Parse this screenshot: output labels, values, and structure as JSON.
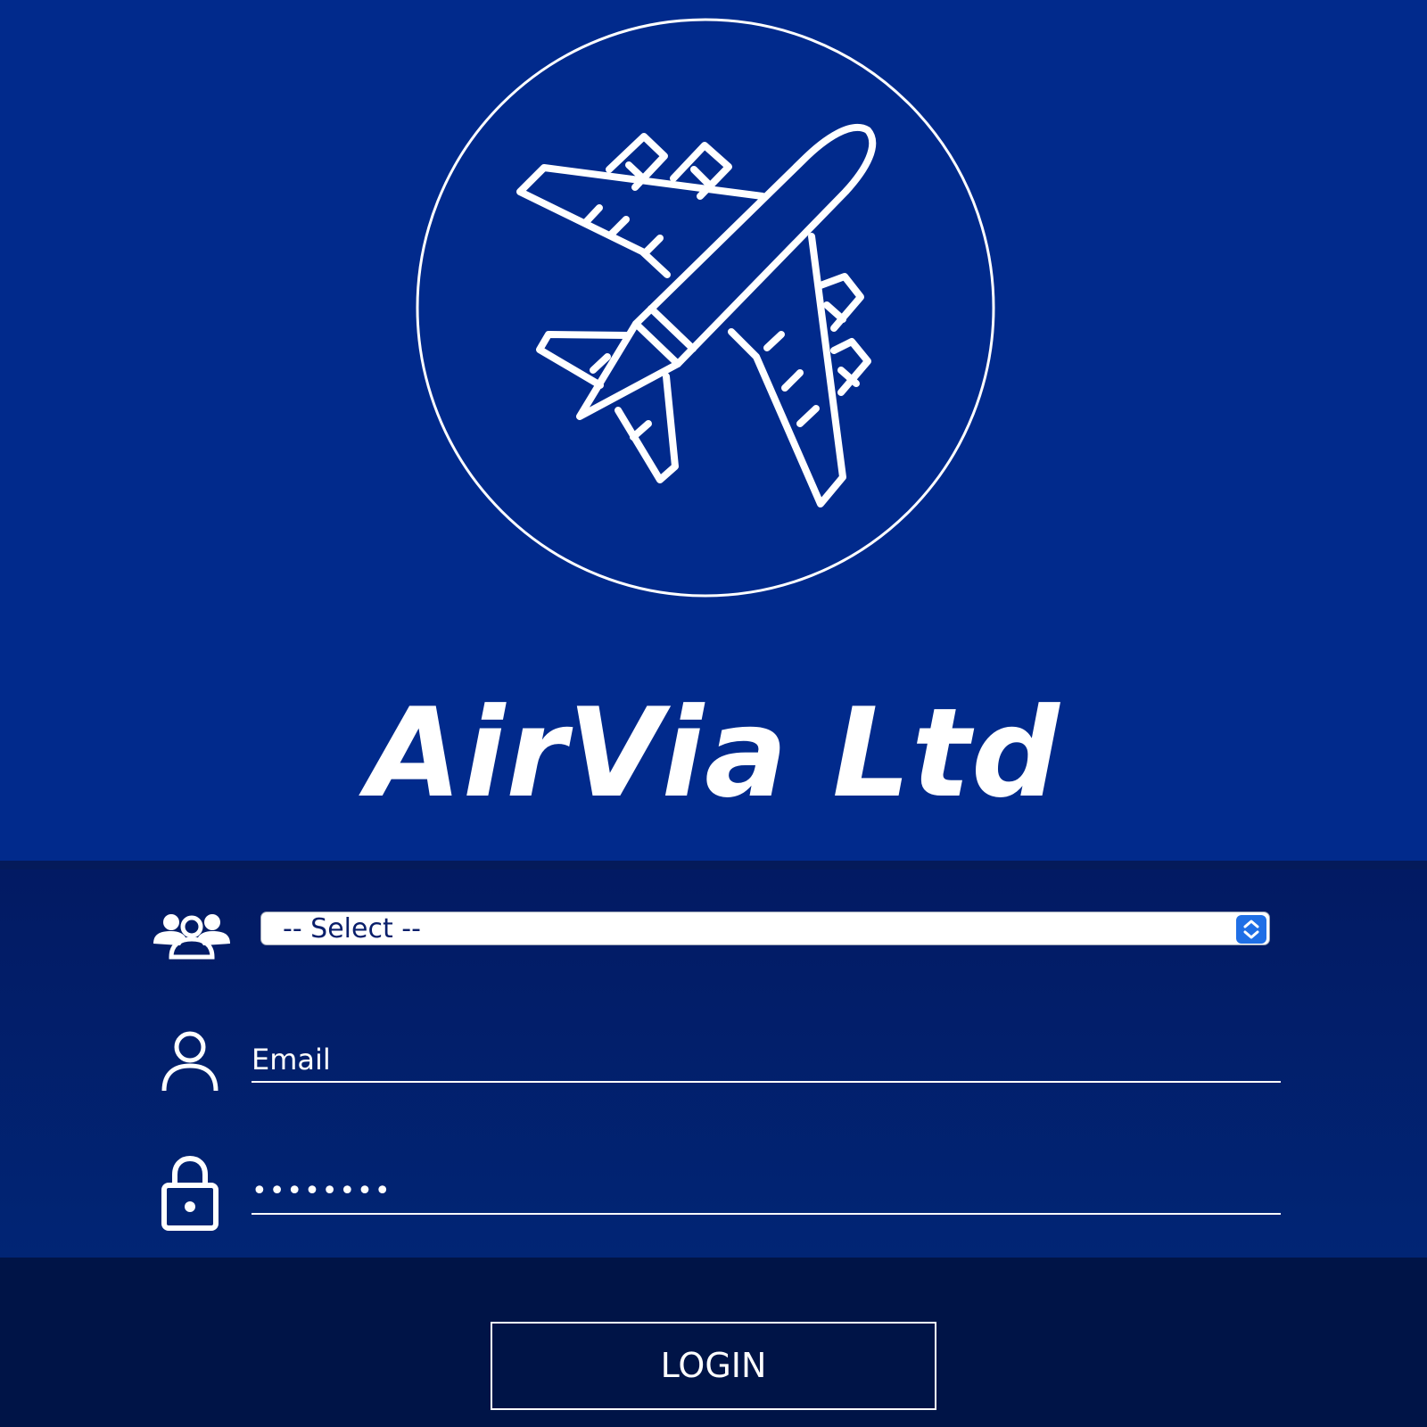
{
  "app": {
    "title": "AirVia Ltd",
    "logo_icon": "airplane-icon",
    "colors": {
      "primary": "#012a8c",
      "form_background": "#021a63",
      "footer": "#001447",
      "text": "#ffffff",
      "select_arrow": "#1f6fe6"
    }
  },
  "form": {
    "role_icon": "group-icon",
    "role_select_value": "-- Select --",
    "email_icon": "user-icon",
    "email_value": "Email",
    "password_icon": "lock-icon",
    "password_value": "••••••••"
  },
  "actions": {
    "login_label": "LOGIN"
  }
}
